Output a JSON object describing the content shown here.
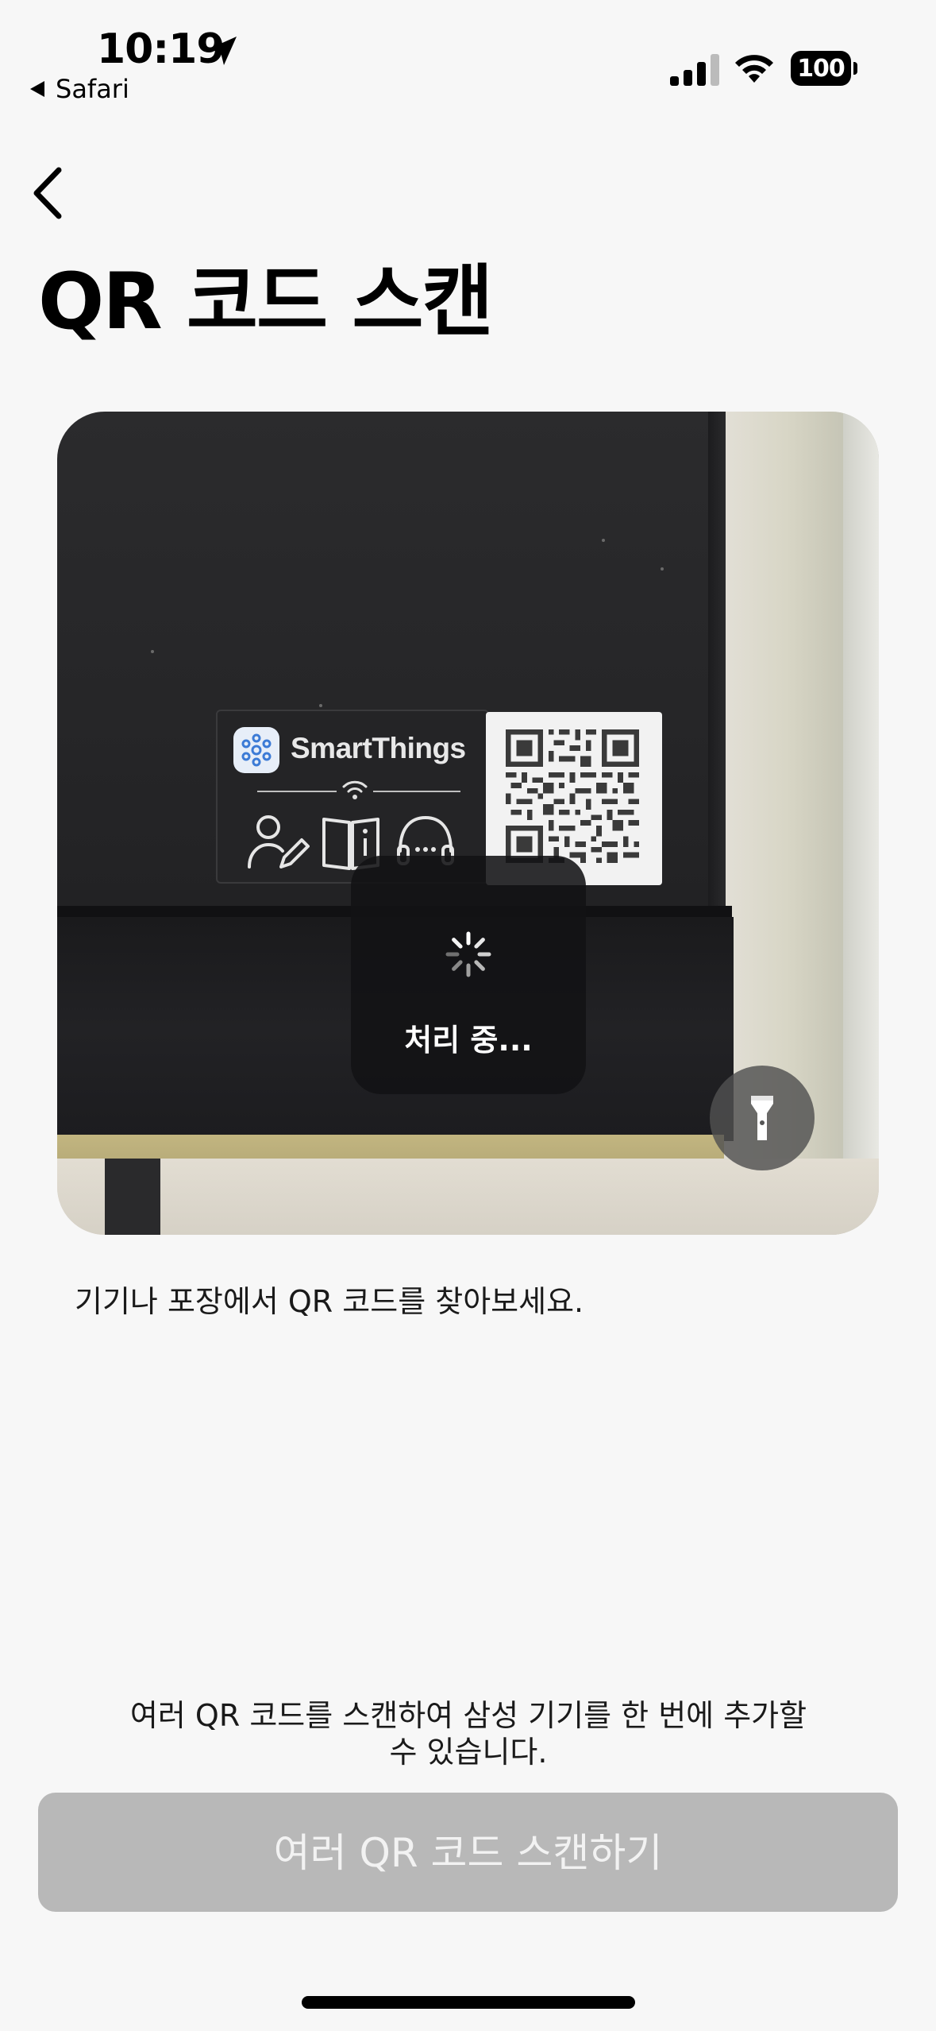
{
  "status_bar": {
    "time": "10:19",
    "back_app": "Safari",
    "battery": "100"
  },
  "page": {
    "title": "QR 코드 스캔"
  },
  "camera": {
    "label_brand": "SmartThings",
    "processing_text": "처리 중..."
  },
  "hint": "기기나 포장에서 QR 코드를 찾아보세요.",
  "info": {
    "line1": "여러 QR 코드를 스캔하여 삼성 기기를 한 번에 추가할",
    "line2": "수 있습니다."
  },
  "scan_multiple_button": {
    "label": "여러 QR 코드 스캔하기",
    "enabled": false
  },
  "colors": {
    "background": "#f7f7f7",
    "disabled_button": "#b8b8b8",
    "hud": "#121214"
  },
  "icons": {
    "nav_back": "chevron-left-icon",
    "flashlight": "flashlight-icon",
    "location": "location-arrow-icon"
  }
}
